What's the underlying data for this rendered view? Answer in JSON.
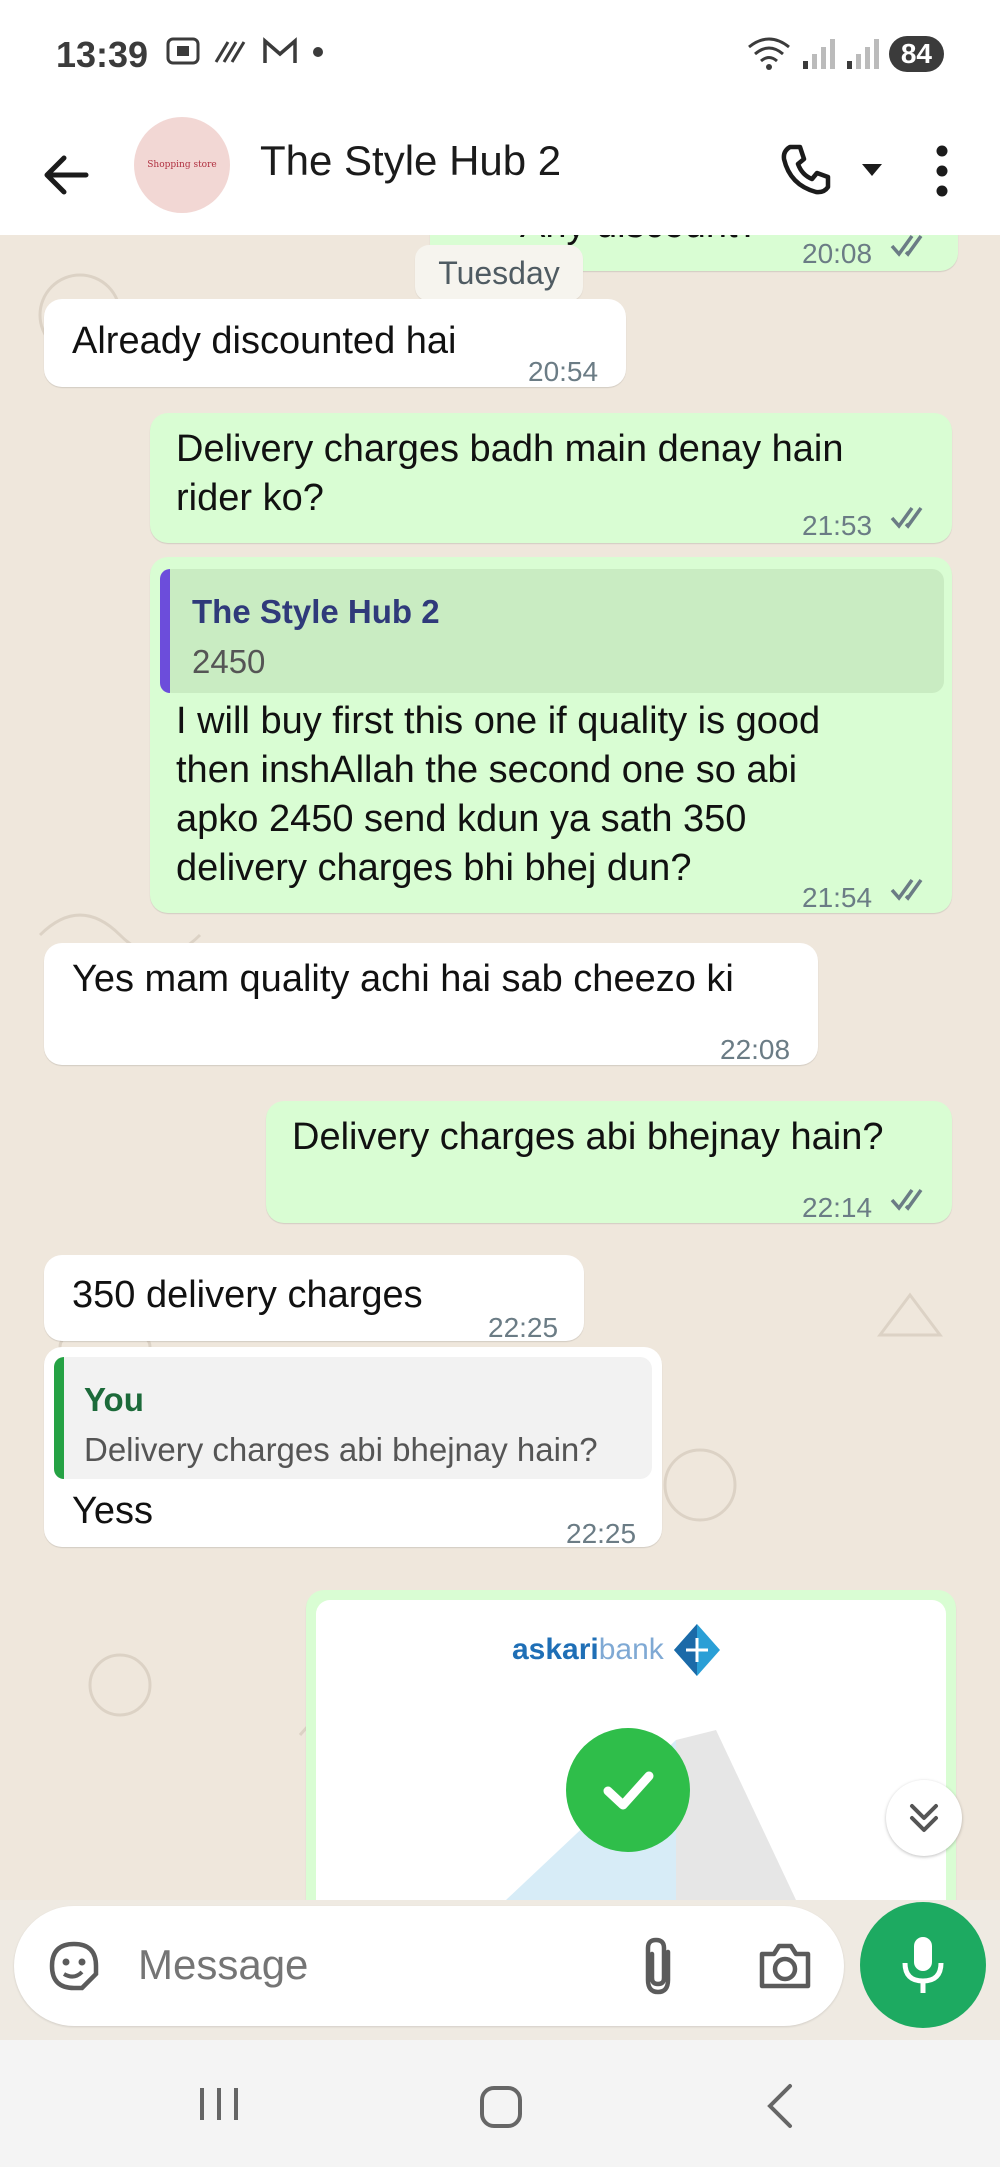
{
  "status_bar": {
    "time": "13:39",
    "battery": "84"
  },
  "header": {
    "contact_name": "The Style Hub 2",
    "avatar_text": "Shopping store"
  },
  "chat": {
    "top_clipped": {
      "text": "Any discount?",
      "time": "20:08"
    },
    "date_divider": "Tuesday",
    "messages": [
      {
        "direction": "in",
        "text": "Already discounted hai",
        "time": "20:54"
      },
      {
        "direction": "out",
        "text_lines": [
          "Delivery charges badh main denay hain",
          "rider ko?"
        ],
        "time": "21:53"
      },
      {
        "direction": "out",
        "quote": {
          "name": "The Style Hub 2",
          "text": "2450"
        },
        "text_lines": [
          "I will buy first this one if quality is good",
          "then inshAllah the second one so abi",
          "apko 2450 send kdun ya sath 350",
          "delivery charges bhi bhej dun?"
        ],
        "time": "21:54"
      },
      {
        "direction": "in",
        "text": "Yes mam quality achi hai sab cheezo ki",
        "time": "22:08"
      },
      {
        "direction": "out",
        "text": "Delivery charges abi bhejnay hain?",
        "time": "22:14"
      },
      {
        "direction": "in",
        "text": "350 delivery charges",
        "time": "22:25"
      },
      {
        "direction": "in",
        "quote": {
          "name": "You",
          "text": "Delivery charges abi bhejnay hain?"
        },
        "text": "Yess",
        "time": "22:25"
      }
    ],
    "image_message": {
      "bank_name_bold": "askari",
      "bank_name_light": "bank"
    }
  },
  "composer": {
    "placeholder": "Message"
  },
  "colors": {
    "out_bubble": "#d9fdd3",
    "in_bubble": "#ffffff",
    "accent": "#1daa61",
    "quote_bar_out": "#6c4ddb",
    "quote_bar_in": "#25a244"
  },
  "icons": [
    "back-arrow-icon",
    "phone-icon",
    "caret-down-icon",
    "more-vert-icon",
    "ticks-icon",
    "sticker-icon",
    "attach-icon",
    "camera-icon",
    "mic-icon",
    "chevrons-down-icon",
    "check-icon"
  ]
}
